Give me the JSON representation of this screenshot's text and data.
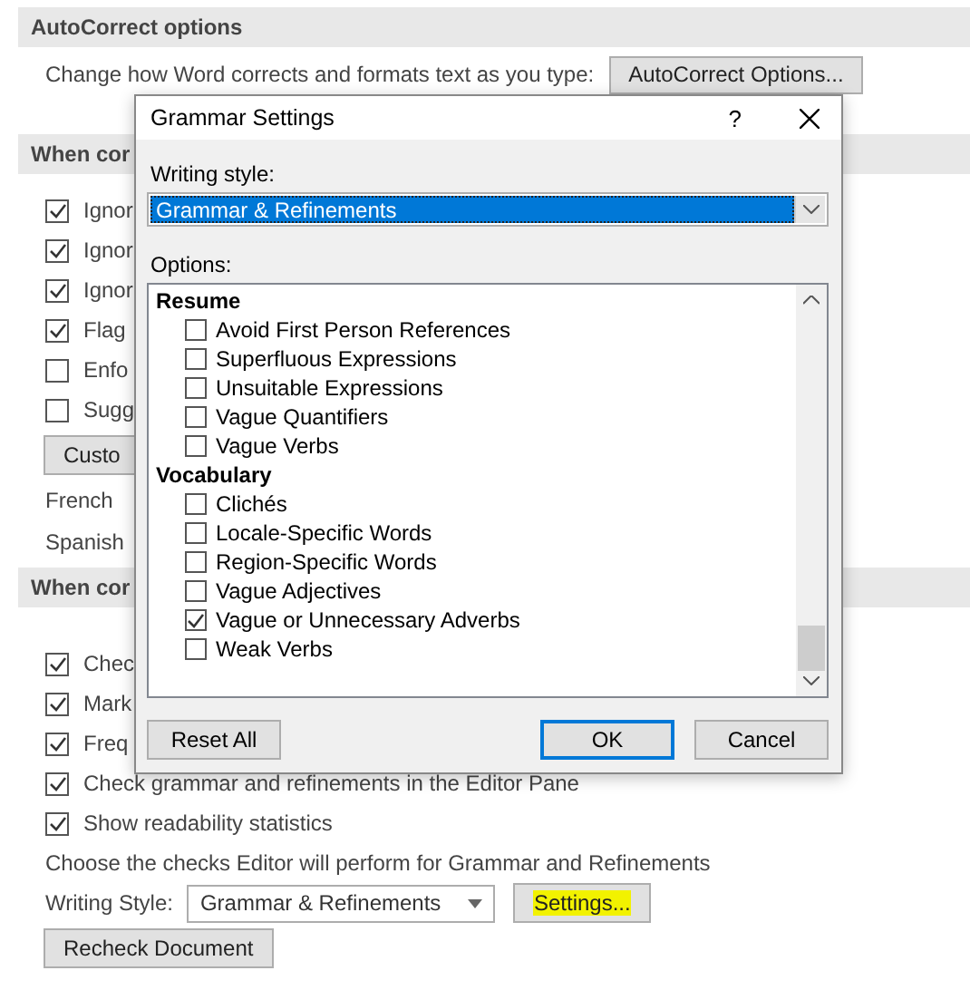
{
  "autocorrect_section": {
    "heading": "AutoCorrect options",
    "description": "Change how Word corrects and formats text as you type:",
    "button": "AutoCorrect Options..."
  },
  "office_section": {
    "heading": "When cor",
    "checkboxes": [
      {
        "label": "Ignor",
        "checked": true
      },
      {
        "label": "Ignor",
        "checked": true
      },
      {
        "label": "Ignor",
        "checked": true
      },
      {
        "label": "Flag",
        "checked": true
      },
      {
        "label": "Enfo",
        "checked": false
      },
      {
        "label": "Sugg",
        "checked": false
      }
    ],
    "button": "Custo",
    "notes": [
      "French",
      "Spanish"
    ]
  },
  "word_section": {
    "heading": "When cor",
    "checkboxes": [
      {
        "label": "Chec",
        "checked": true
      },
      {
        "label": "Mark",
        "checked": true
      },
      {
        "label": "Freq",
        "checked": true
      },
      {
        "label": "Check grammar and refinements in the Editor Pane",
        "checked": true
      },
      {
        "label": "Show readability statistics",
        "checked": true
      }
    ],
    "caption": "Choose the checks Editor will perform for Grammar and Refinements",
    "writing_style": {
      "label": "Writing Style:",
      "value": "Grammar & Refinements"
    },
    "settings_button": {
      "label": "Settings...",
      "highlighted": true
    },
    "recheck_button": "Recheck Document"
  },
  "dialog": {
    "title": "Grammar Settings",
    "help": "?",
    "writing_style": {
      "label": "Writing style:",
      "value": "Grammar & Refinements",
      "selected": true
    },
    "options_label": "Options:",
    "options": [
      {
        "kind": "group",
        "label": "Resume"
      },
      {
        "kind": "option",
        "label": "Avoid First Person References",
        "checked": false
      },
      {
        "kind": "option",
        "label": "Superfluous Expressions",
        "checked": false
      },
      {
        "kind": "option",
        "label": "Unsuitable Expressions",
        "checked": false
      },
      {
        "kind": "option",
        "label": "Vague Quantifiers",
        "checked": false
      },
      {
        "kind": "option",
        "label": "Vague Verbs",
        "checked": false
      },
      {
        "kind": "group",
        "label": "Vocabulary"
      },
      {
        "kind": "option",
        "label": "Clichés",
        "checked": false
      },
      {
        "kind": "option",
        "label": "Locale-Specific Words",
        "checked": false
      },
      {
        "kind": "option",
        "label": "Region-Specific Words",
        "checked": false
      },
      {
        "kind": "option",
        "label": "Vague Adjectives",
        "checked": false
      },
      {
        "kind": "option",
        "label": "Vague or Unnecessary Adverbs",
        "checked": true
      },
      {
        "kind": "option",
        "label": "Weak Verbs",
        "checked": false
      }
    ],
    "buttons": [
      {
        "label": "Reset All",
        "default": false
      },
      {
        "label": "OK",
        "default": true
      },
      {
        "label": "Cancel",
        "default": false
      }
    ]
  }
}
